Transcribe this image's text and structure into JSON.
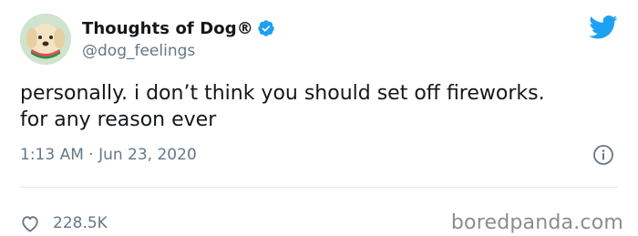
{
  "tweet": {
    "display_name": "Thoughts of Dog®",
    "handle": "@dog_feelings",
    "text": "personally. i don’t think you should set off fireworks.\nfor any reason ever",
    "timestamp": "1:13 AM · Jun 23, 2020",
    "likes": "228.5K"
  },
  "watermark": "boredpanda.com",
  "colors": {
    "text": "#14171a",
    "secondary": "#657786",
    "twitter_blue": "#1da1f2",
    "divider": "#e1e8ed"
  },
  "icons": [
    "avatar",
    "verified-badge-icon",
    "twitter-bird-icon",
    "info-icon",
    "heart-icon"
  ]
}
